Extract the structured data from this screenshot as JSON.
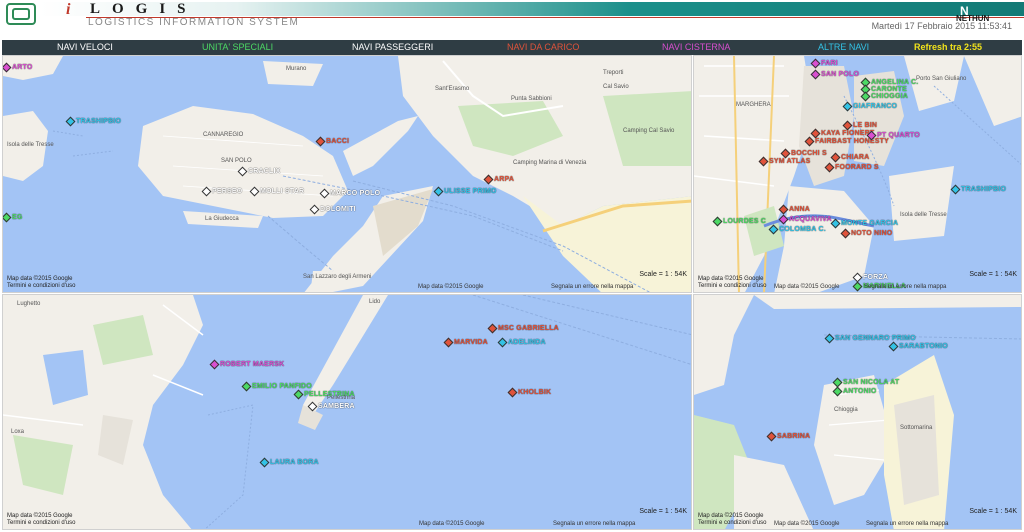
{
  "header": {
    "brand_prefix": "i",
    "brand": "LOGIS",
    "subtitle": "LOGISTICS INFORMATION SYSTEM",
    "company": "NETHUN",
    "datetime": "Martedì 17 Febbraio 2015   11:53:41"
  },
  "categories": [
    {
      "label": "NAVI VELOCI",
      "color": "#ffffff"
    },
    {
      "label": "UNITA' SPECIALI",
      "color": "#4cd964"
    },
    {
      "label": "NAVI PASSEGGERI",
      "color": "#ffffff"
    },
    {
      "label": "NAVI DA CARICO",
      "color": "#e0533b"
    },
    {
      "label": "NAVI CISTERNA",
      "color": "#d94fd0"
    },
    {
      "label": "ALTRE NAVI",
      "color": "#33c3e6"
    }
  ],
  "refresh": {
    "label": "Refresh tra 2:55",
    "color": "#f2e31b"
  },
  "colors": {
    "water": "#a3c4f5",
    "land": "#f2efe9",
    "green": "#cfe6c0",
    "road": "#ffffff",
    "highway": "#f5d07a"
  },
  "panels": {
    "venezia": {
      "scale": "Scale = 1 : 54K",
      "map_data": "Map data ©2015 Google",
      "terms": "Termini e condizioni d'uso",
      "report": "Segnala un errore nella mappa",
      "places": [
        "Sant'Erasmo",
        "Punta Sabbioni",
        "Cal Savio",
        "Treporti",
        "San Lazzaro degli Armeni",
        "Isola delle Tresse",
        "Camping Marina di Venezia",
        "Camping Cal Savio",
        "La Giudecca",
        "Murano",
        "SAN POLO",
        "CANNAREGIO"
      ],
      "ships": [
        {
          "name": "ARTO",
          "color": "#d94fd0",
          "type": "cisterna"
        },
        {
          "name": "TRASHIPBIO",
          "color": "#33c3e6",
          "type": "altre"
        },
        {
          "name": "BACCI",
          "color": "#e0533b",
          "type": "carico"
        },
        {
          "name": "CRACLIX",
          "color": "#ffffff",
          "type": "passeggeri"
        },
        {
          "name": "ULISSE PRIMO",
          "color": "#33c3e6",
          "type": "altre"
        },
        {
          "name": "ARPA",
          "color": "#e0533b",
          "type": "carico"
        },
        {
          "name": "MARCO POLO",
          "color": "#ffffff",
          "type": "passeggeri"
        },
        {
          "name": "PERSEO",
          "color": "#ffffff",
          "type": "passeggeri"
        },
        {
          "name": "MOLLI STAR",
          "color": "#ffffff",
          "type": "passeggeri"
        },
        {
          "name": "DOLOMITI",
          "color": "#ffffff",
          "type": "passeggeri"
        },
        {
          "name": "EG",
          "color": "#4cd964",
          "type": "speciali"
        }
      ]
    },
    "marghera": {
      "scale": "Scale = 1 : 54K",
      "map_data": "Map data ©2015 Google",
      "terms": "Termini e condizioni d'uso",
      "report": "Segnala un errore nella mappa",
      "places": [
        "MARGHERA",
        "Isola delle Tresse",
        "Porto San Giuliano"
      ],
      "ships": [
        {
          "name": "FARI",
          "color": "#d94fd0",
          "type": "cisterna"
        },
        {
          "name": "SAN POLO",
          "color": "#d94fd0",
          "type": "cisterna"
        },
        {
          "name": "ANGELINA C.",
          "color": "#4cd964",
          "type": "speciali"
        },
        {
          "name": "CARONTE",
          "color": "#4cd964",
          "type": "speciali"
        },
        {
          "name": "CHIOGGIA",
          "color": "#4cd964",
          "type": "speciali"
        },
        {
          "name": "GIAFRANCO",
          "color": "#33c3e6",
          "type": "altre"
        },
        {
          "name": "LE BIN",
          "color": "#e0533b",
          "type": "carico"
        },
        {
          "name": "KAYA FIONERT",
          "color": "#e0533b",
          "type": "carico"
        },
        {
          "name": "FAIRBAST HONESTY",
          "color": "#e0533b",
          "type": "carico"
        },
        {
          "name": "PT QUARTO",
          "color": "#d94fd0",
          "type": "cisterna"
        },
        {
          "name": "BOCCHI S",
          "color": "#e0533b",
          "type": "carico"
        },
        {
          "name": "SYM ATLAS",
          "color": "#e0533b",
          "type": "carico"
        },
        {
          "name": "CHIARA",
          "color": "#e0533b",
          "type": "carico"
        },
        {
          "name": "FOORARD S",
          "color": "#e0533b",
          "type": "carico"
        },
        {
          "name": "TRASHIPBIO",
          "color": "#33c3e6",
          "type": "altre"
        },
        {
          "name": "ANNA",
          "color": "#e0533b",
          "type": "carico"
        },
        {
          "name": "ACQUAVIVA",
          "color": "#d94fd0",
          "type": "cisterna"
        },
        {
          "name": "LOURDES C",
          "color": "#4cd964",
          "type": "speciali"
        },
        {
          "name": "COLOMBA C.",
          "color": "#33c3e6",
          "type": "altre"
        },
        {
          "name": "MONTE GARCIA",
          "color": "#33c3e6",
          "type": "altre"
        },
        {
          "name": "NOTO NINO",
          "color": "#e0533b",
          "type": "carico"
        },
        {
          "name": "FORZA",
          "color": "#ffffff",
          "type": "passeggeri"
        },
        {
          "name": "MARINELLA",
          "color": "#4cd964",
          "type": "speciali"
        }
      ]
    },
    "lido": {
      "scale": "Scale = 1 : 54K",
      "map_data": "Map data ©2015 Google",
      "terms": "Termini e condizioni d'uso",
      "report": "Segnala un errore nella mappa",
      "places": [
        "Lughetto",
        "Lido",
        "Loxa",
        "Pellestrina"
      ],
      "ships": [
        {
          "name": "MSC GABRIELLA",
          "color": "#e0533b",
          "type": "carico"
        },
        {
          "name": "MARVIDA",
          "color": "#e0533b",
          "type": "carico"
        },
        {
          "name": "ADELINDA",
          "color": "#33c3e6",
          "type": "altre"
        },
        {
          "name": "ROBERT MAERSK",
          "color": "#d94fd0",
          "type": "cisterna"
        },
        {
          "name": "EMILIO PANFIDO",
          "color": "#4cd964",
          "type": "speciali"
        },
        {
          "name": "PELLESTRINA",
          "color": "#4cd964",
          "type": "speciali"
        },
        {
          "name": "SAMBERA",
          "color": "#ffffff",
          "type": "passeggeri"
        },
        {
          "name": "KHOLBIK",
          "color": "#e0533b",
          "type": "carico"
        },
        {
          "name": "LAURA BORA",
          "color": "#33c3e6",
          "type": "altre"
        }
      ]
    },
    "chioggia": {
      "scale": "Scale = 1 : 54K",
      "map_data": "Map data ©2015 Google",
      "terms": "Termini e condizioni d'uso",
      "report": "Segnala un errore nella mappa",
      "places": [
        "Chioggia",
        "Sottomarina"
      ],
      "ships": [
        {
          "name": "SAN GENNARO PRIMO",
          "color": "#33c3e6",
          "type": "altre"
        },
        {
          "name": "SARABTONIO",
          "color": "#33c3e6",
          "type": "altre"
        },
        {
          "name": "SAN NICOLA AT",
          "color": "#4cd964",
          "type": "speciali"
        },
        {
          "name": "ANTONIO",
          "color": "#4cd964",
          "type": "speciali"
        },
        {
          "name": "SABRINA",
          "color": "#e0533b",
          "type": "carico"
        }
      ]
    }
  }
}
